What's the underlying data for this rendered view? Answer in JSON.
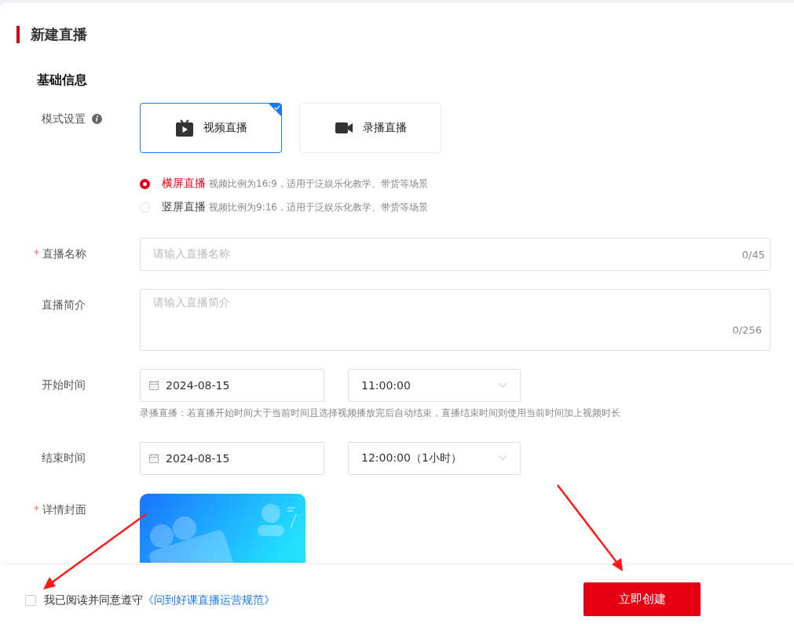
{
  "title": "新建直播",
  "section": "基础信息",
  "mode": {
    "label": "模式设置",
    "options": [
      {
        "label": "视频直播",
        "kind": "tv",
        "selected": true
      },
      {
        "label": "录播直播",
        "kind": "camera",
        "selected": false
      }
    ]
  },
  "orientations": [
    {
      "label": "横屏直播",
      "desc": "视频比例为16:9，适用于泛娱乐化教学、带货等场景",
      "selected": true
    },
    {
      "label": "竖屏直播",
      "desc": "视频比例为9:16，适用于泛娱乐化教学、带货等场景",
      "selected": false
    }
  ],
  "name": {
    "label": "直播名称",
    "required_mark": "*",
    "placeholder": "请输入直播名称",
    "counter": "0/45"
  },
  "intro": {
    "label": "直播简介",
    "placeholder": "请输入直播简介",
    "counter": "0/256"
  },
  "start": {
    "label": "开始时间",
    "date": "2024-08-15",
    "time": "11:00:00",
    "hint": "录播直播：若直播开始时间大于当前时间且选择视频播放完后自动结束，直播结束时间则使用当前时间加上视频时长"
  },
  "end": {
    "label": "结束时间",
    "date": "2024-08-15",
    "time": "12:00:00（1小时）"
  },
  "cover": {
    "label": "详情封面",
    "required_mark": "*"
  },
  "footer": {
    "agree_checked": false,
    "agree_text": "我已阅读并同意遵守",
    "link": "《问到好课直播运营规范》",
    "button": "立即创建"
  }
}
